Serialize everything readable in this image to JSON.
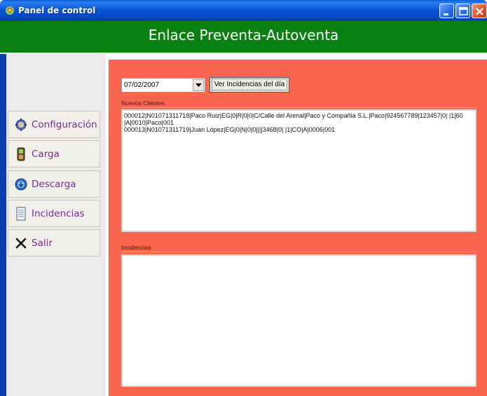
{
  "window": {
    "title": "Panel de control"
  },
  "header": {
    "title": "Enlace Preventa-Autoventa"
  },
  "sidebar": {
    "items": [
      {
        "label": "Configuración",
        "icon": "gear-icon"
      },
      {
        "label": "Carga",
        "icon": "phone-device-icon"
      },
      {
        "label": "Descarga",
        "icon": "globe-download-icon"
      },
      {
        "label": "Incidencias",
        "icon": "document-icon"
      },
      {
        "label": "Salir",
        "icon": "close-x-icon"
      }
    ]
  },
  "controls": {
    "date_value": "07/02/2007",
    "ver_button": "Ver Incidencias del día"
  },
  "nuevos_clientes": {
    "label": "Nuevos Clientes",
    "lines": [
      "000012|N01071311718|Paco Ruiz|EG|0|R|0|0|C/Calle del Arenal|Paco y Compañia S.L.|Paco|924567789|123457|0| |1|60",
      "|A|0010|Paco|001",
      "000013|N01071311719|Juan López|EG|0|N|0|0||||3468|0| |1|CO|A|0006|001"
    ]
  },
  "incidencias": {
    "label": "Incidencias",
    "lines": []
  },
  "colors": {
    "header_green": "#0a7f12",
    "content_red": "#fa6550",
    "sidebar_label": "#7b2b91"
  }
}
